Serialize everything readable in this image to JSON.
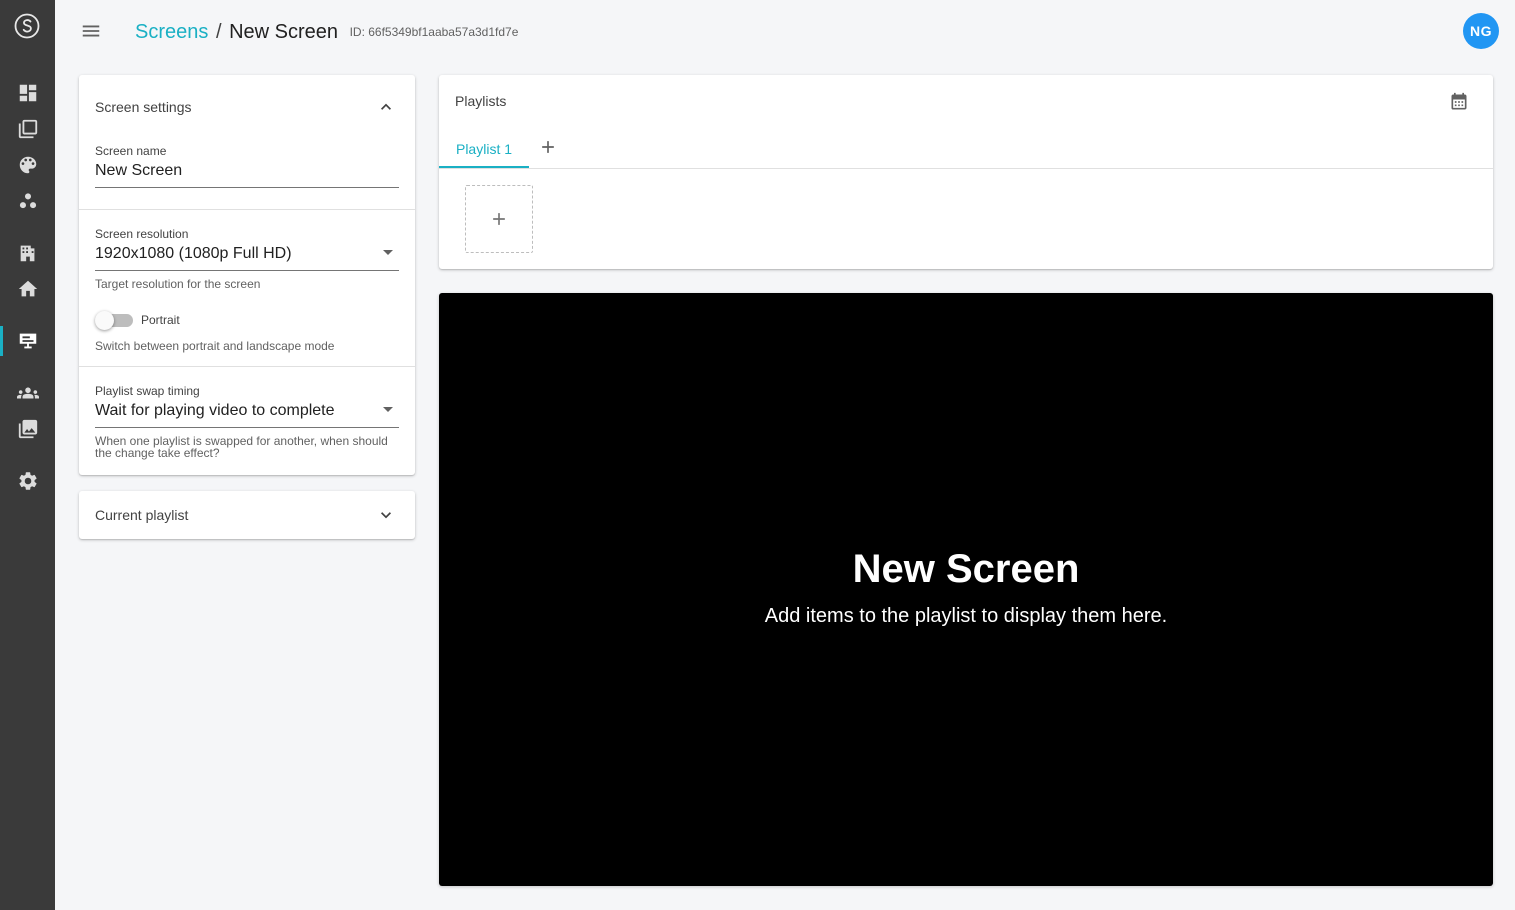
{
  "sidebar": {
    "logo_icon": "brand-s-logo-icon",
    "items": [
      {
        "icon": "dashboard-icon",
        "active": false
      },
      {
        "icon": "collections-icon",
        "active": false
      },
      {
        "icon": "palette-icon",
        "active": false
      },
      {
        "icon": "bubble-chart-icon",
        "active": false
      },
      {
        "icon": "building-icon",
        "active": false
      },
      {
        "icon": "home-icon",
        "active": false
      },
      {
        "icon": "screen-sign-icon",
        "active": true
      },
      {
        "icon": "people-icon",
        "active": false
      },
      {
        "icon": "photo-library-icon",
        "active": false
      },
      {
        "icon": "settings-icon",
        "active": false
      }
    ],
    "active_color": "#1ab0c4",
    "background": "#3a3a3a"
  },
  "header": {
    "breadcrumb_link": "Screens",
    "breadcrumb_sep": "/",
    "breadcrumb_current": "New Screen",
    "id_text": "ID: 66f5349bf1aaba57a3d1fd7e",
    "avatar_initials": "NG",
    "avatar_color": "#2196f3"
  },
  "settings": {
    "title": "Screen settings",
    "screen_name_label": "Screen name",
    "screen_name_value": "New Screen",
    "resolution_label": "Screen resolution",
    "resolution_value": "1920x1080 (1080p Full HD)",
    "resolution_hint": "Target resolution for the screen",
    "portrait_label": "Portrait",
    "portrait_on": false,
    "portrait_hint": "Switch between portrait and landscape mode",
    "swap_label": "Playlist swap timing",
    "swap_value": "Wait for playing video to complete",
    "swap_hint": "When one playlist is swapped for another, when should the change take effect?"
  },
  "current_playlist": {
    "title": "Current playlist"
  },
  "playlists": {
    "title": "Playlists",
    "tabs": [
      {
        "label": "Playlist 1",
        "active": true
      }
    ],
    "accent": "#1ab0c4"
  },
  "preview": {
    "title": "New Screen",
    "subtitle": "Add items to the playlist to display them here."
  }
}
